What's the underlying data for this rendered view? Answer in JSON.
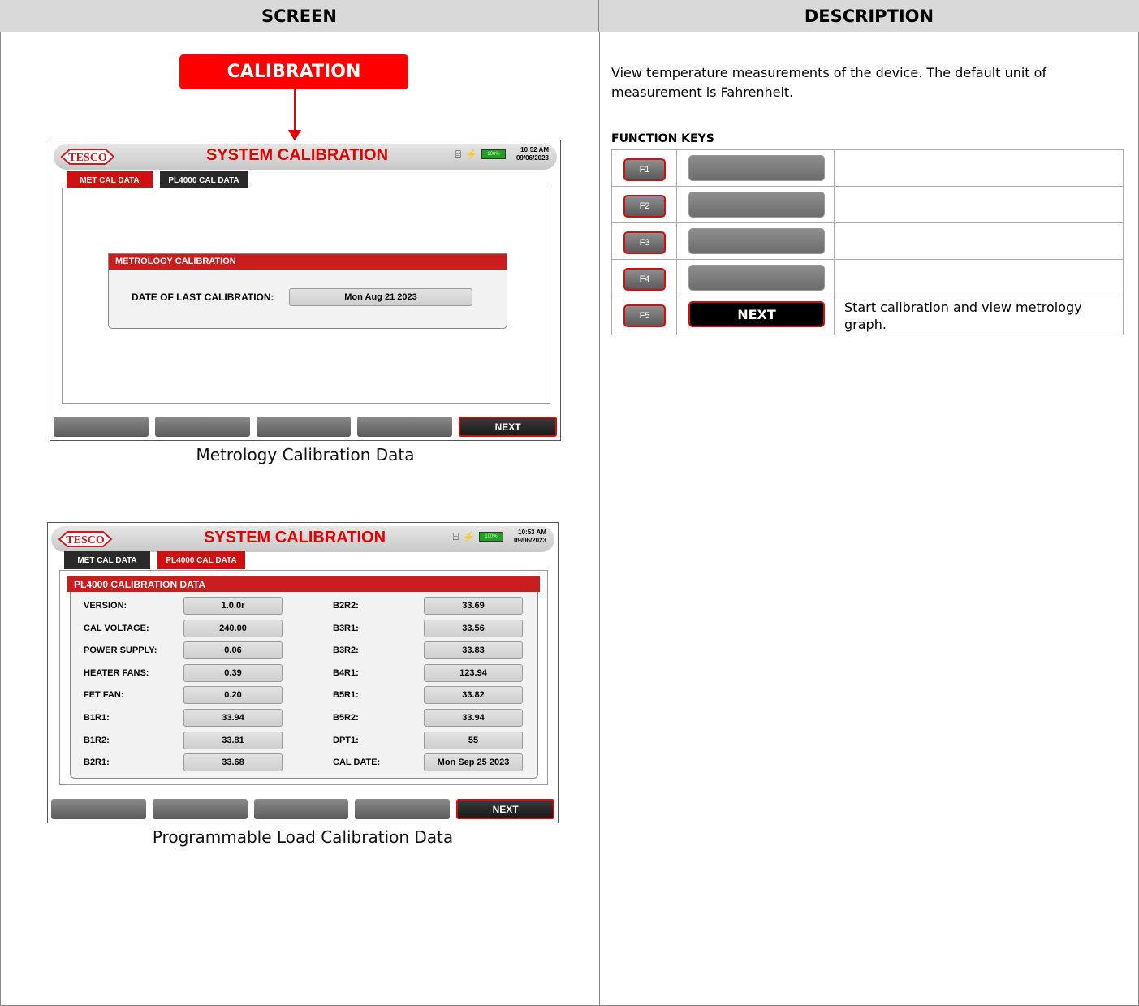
{
  "headers": {
    "screen": "SCREEN",
    "description": "DESCRIPTION"
  },
  "callout": "CALIBRATION",
  "screen1": {
    "title": "SYSTEM CALIBRATION",
    "time": "10:52 AM",
    "date": "09/06/2023",
    "battery": "100%",
    "tabs": [
      "MET CAL DATA",
      "PL4000 CAL DATA"
    ],
    "active_tab": "MET CAL DATA",
    "panel_title": "METROLOGY CALIBRATION",
    "last_cal_label": "DATE OF LAST CALIBRATION:",
    "last_cal_value": "Mon Aug 21 2023",
    "fkeys": [
      "",
      "",
      "",
      "",
      "NEXT"
    ],
    "caption": "Metrology Calibration Data"
  },
  "screen2": {
    "title": "SYSTEM CALIBRATION",
    "time": "10:53 AM",
    "date": "09/06/2023",
    "battery": "100%",
    "tabs": [
      "MET CAL DATA",
      "PL4000 CAL DATA"
    ],
    "active_tab": "PL4000 CAL DATA",
    "panel_title": "PL4000 CALIBRATION DATA",
    "left": [
      {
        "label": "VERSION:",
        "value": "1.0.0r"
      },
      {
        "label": "CAL VOLTAGE:",
        "value": "240.00"
      },
      {
        "label": "POWER SUPPLY:",
        "value": "0.06"
      },
      {
        "label": "HEATER FANS:",
        "value": "0.39"
      },
      {
        "label": "FET FAN:",
        "value": "0.20"
      },
      {
        "label": "B1R1:",
        "value": "33.94"
      },
      {
        "label": "B1R2:",
        "value": "33.81"
      },
      {
        "label": "B2R1:",
        "value": "33.68"
      }
    ],
    "right": [
      {
        "label": "B2R2:",
        "value": "33.69"
      },
      {
        "label": "B3R1:",
        "value": "33.56"
      },
      {
        "label": "B3R2:",
        "value": "33.83"
      },
      {
        "label": "B4R1:",
        "value": "123.94"
      },
      {
        "label": "B5R1:",
        "value": "33.82"
      },
      {
        "label": "B5R2:",
        "value": "33.94"
      },
      {
        "label": "DPT1:",
        "value": "55"
      },
      {
        "label": "CAL DATE:",
        "value": "Mon Sep 25 2023"
      }
    ],
    "fkeys": [
      "",
      "",
      "",
      "",
      "NEXT"
    ],
    "caption": "Programmable Load Calibration Data"
  },
  "description": {
    "text": "View temperature measurements of the device. The default unit of measurement is Fahrenheit.",
    "function_keys_title": "FUNCTION KEYS",
    "function_keys": [
      {
        "key": "F1",
        "label": "",
        "desc": ""
      },
      {
        "key": "F2",
        "label": "",
        "desc": ""
      },
      {
        "key": "F3",
        "label": "",
        "desc": ""
      },
      {
        "key": "F4",
        "label": "",
        "desc": ""
      },
      {
        "key": "F5",
        "label": "NEXT",
        "desc": "Start calibration and view metrology graph."
      }
    ]
  },
  "colors": {
    "accent_red": "#e00000",
    "panel_red": "#c81e1e",
    "battery_green": "#22a022"
  }
}
